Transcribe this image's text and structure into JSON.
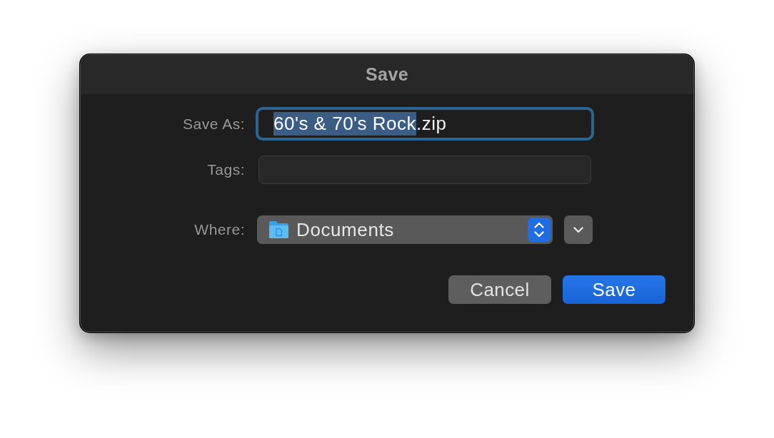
{
  "window": {
    "title": "Save"
  },
  "save_as": {
    "label": "Save As:",
    "focused": true,
    "value_parts": [
      {
        "text": "60's & 70's Rock",
        "selected": true
      },
      {
        "text": ".zip",
        "selected": false
      }
    ]
  },
  "tags": {
    "label": "Tags:"
  },
  "where": {
    "label": "Where:",
    "value": "Documents",
    "expanded": false
  },
  "buttons": [
    {
      "label": "Cancel",
      "kind": "secondary"
    },
    {
      "label": "Save",
      "kind": "default"
    }
  ]
}
